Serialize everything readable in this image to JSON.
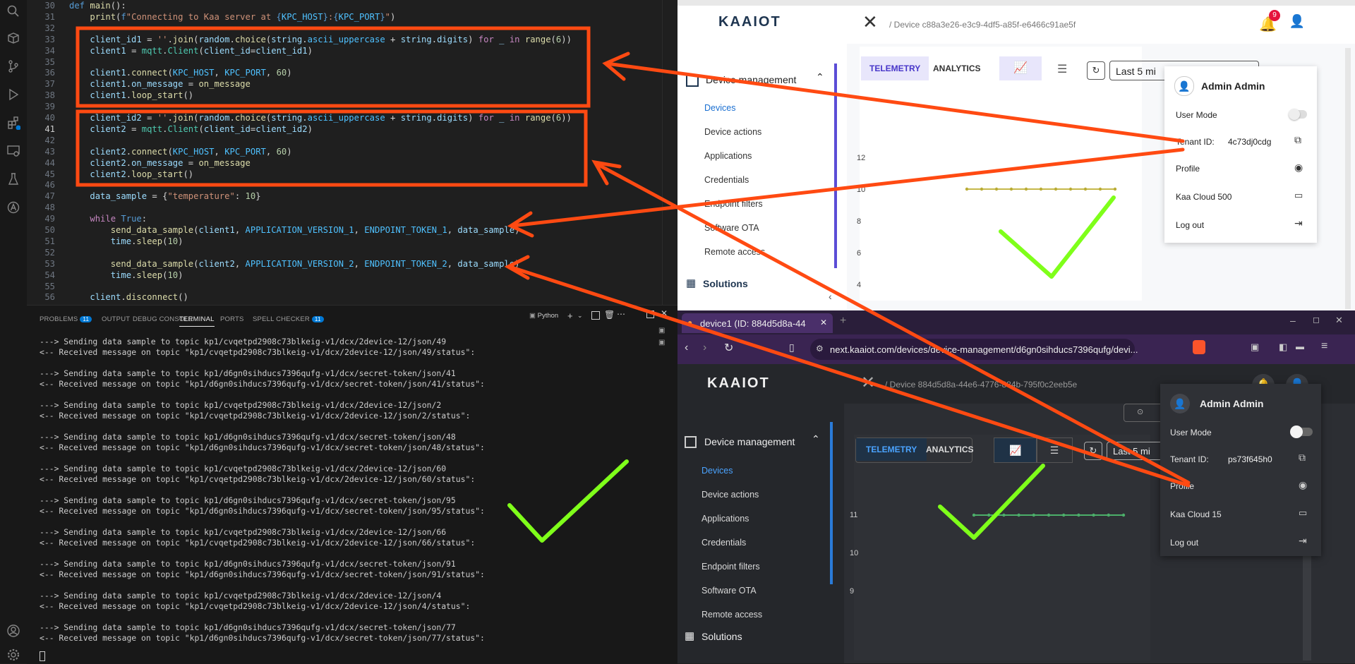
{
  "vscode": {
    "code_lines": [
      {
        "n": "30",
        "html": "<span class='kw'>def</span> <span class='fn'>main</span>():"
      },
      {
        "n": "31",
        "html": "    <span class='fn'>print</span>(<span class='kw'>f</span><span class='str'>\"Connecting to Kaa server at </span><span class='kw'>{</span><span class='const'>KPC_HOST</span><span class='kw'>}</span><span class='str'>:</span><span class='kw'>{</span><span class='const'>KPC_PORT</span><span class='kw'>}</span><span class='str'>\"</span>)"
      },
      {
        "n": "32",
        "html": ""
      },
      {
        "n": "33",
        "html": "    <span class='var'>client_id1</span> = <span class='str'>''</span>.<span class='fn'>join</span>(<span class='var'>random</span>.<span class='fn'>choice</span>(<span class='var'>string</span>.<span class='const'>ascii_uppercase</span> + <span class='var'>string</span>.<span class='var'>digits</span>) <span class='kw2'>for</span> <span class='var'>_</span> <span class='kw2'>in</span> <span class='fn'>range</span>(<span class='num'>6</span>))"
      },
      {
        "n": "34",
        "html": "    <span class='var'>client1</span> = <span class='cls'>mqtt</span>.<span class='cls'>Client</span>(<span class='var'>client_id</span>=<span class='var'>client_id1</span>)"
      },
      {
        "n": "35",
        "html": ""
      },
      {
        "n": "36",
        "html": "    <span class='var'>client1</span>.<span class='fn'>connect</span>(<span class='const'>KPC_HOST</span>, <span class='const'>KPC_PORT</span>, <span class='num'>60</span>)"
      },
      {
        "n": "37",
        "html": "    <span class='var'>client1</span>.<span class='var'>on_message</span> = <span class='fn'>on_message</span>"
      },
      {
        "n": "38",
        "html": "    <span class='var'>client1</span>.<span class='fn'>loop_start</span>()"
      },
      {
        "n": "39",
        "html": ""
      },
      {
        "n": "40",
        "html": "    <span class='var'>client_id2</span> = <span class='str'>''</span>.<span class='fn'>join</span>(<span class='var'>random</span>.<span class='fn'>choice</span>(<span class='var'>string</span>.<span class='const'>ascii_uppercase</span> + <span class='var'>string</span>.<span class='var'>digits</span>) <span class='kw2'>for</span> <span class='var'>_</span> <span class='kw2'>in</span> <span class='fn'>range</span>(<span class='num'>6</span>))"
      },
      {
        "n": "41",
        "html": "    <span class='var'>client2</span> = <span class='cls'>mqtt</span>.<span class='cls'>Client</span>(<span class='var'>client_id</span>=<span class='var'>client_id2</span>)"
      },
      {
        "n": "42",
        "html": ""
      },
      {
        "n": "43",
        "html": "    <span class='var'>client2</span>.<span class='fn'>connect</span>(<span class='const'>KPC_HOST</span>, <span class='const'>KPC_PORT</span>, <span class='num'>60</span>)"
      },
      {
        "n": "44",
        "html": "    <span class='var'>client2</span>.<span class='var'>on_message</span> = <span class='fn'>on_message</span>"
      },
      {
        "n": "45",
        "html": "    <span class='var'>client2</span>.<span class='fn'>loop_start</span>()"
      },
      {
        "n": "46",
        "html": ""
      },
      {
        "n": "47",
        "html": "    <span class='var'>data_sample</span> = {<span class='str'>\"temperature\"</span>: <span class='num'>10</span>}"
      },
      {
        "n": "48",
        "html": ""
      },
      {
        "n": "49",
        "html": "    <span class='kw2'>while</span> <span class='kw'>True</span>:"
      },
      {
        "n": "50",
        "html": "        <span class='fn'>send_data_sample</span>(<span class='var'>client1</span>, <span class='const'>APPLICATION_VERSION_1</span>, <span class='const'>ENDPOINT_TOKEN_1</span>, <span class='var'>data_sample</span>)"
      },
      {
        "n": "51",
        "html": "        <span class='var'>time</span>.<span class='fn'>sleep</span>(<span class='num'>10</span>)"
      },
      {
        "n": "52",
        "html": ""
      },
      {
        "n": "53",
        "html": "        <span class='fn'>send_data_sample</span>(<span class='var'>client2</span>, <span class='const'>APPLICATION_VERSION_2</span>, <span class='const'>ENDPOINT_TOKEN_2</span>, <span class='var'>data_sample</span>)"
      },
      {
        "n": "54",
        "html": "        <span class='var'>time</span>.<span class='fn'>sleep</span>(<span class='num'>10</span>)"
      },
      {
        "n": "55",
        "html": ""
      },
      {
        "n": "56",
        "html": "    <span class='var'>client</span>.<span class='fn'>disconnect</span>()"
      }
    ],
    "active_line": "41",
    "panel_tabs": [
      {
        "label": "PROBLEMS",
        "badge": "11"
      },
      {
        "label": "OUTPUT",
        "badge": ""
      },
      {
        "label": "DEBUG CONSOLE",
        "badge": ""
      },
      {
        "label": "TERMINAL",
        "badge": ""
      },
      {
        "label": "PORTS",
        "badge": ""
      },
      {
        "label": "SPELL CHECKER",
        "badge": "11"
      }
    ],
    "terminal_kind": "Python",
    "terminal_lines": [
      "---> Sending data sample to topic kp1/cvqetpd2908c73blkeig-v1/dcx/2device-12/json/49",
      "<-- Received message on topic \"kp1/cvqetpd2908c73blkeig-v1/dcx/2device-12/json/49/status\":",
      "",
      "---> Sending data sample to topic kp1/d6gn0sihducs7396qufg-v1/dcx/secret-token/json/41",
      "<-- Received message on topic \"kp1/d6gn0sihducs7396qufg-v1/dcx/secret-token/json/41/status\":",
      "",
      "---> Sending data sample to topic kp1/cvqetpd2908c73blkeig-v1/dcx/2device-12/json/2",
      "<-- Received message on topic \"kp1/cvqetpd2908c73blkeig-v1/dcx/2device-12/json/2/status\":",
      "",
      "---> Sending data sample to topic kp1/d6gn0sihducs7396qufg-v1/dcx/secret-token/json/48",
      "<-- Received message on topic \"kp1/d6gn0sihducs7396qufg-v1/dcx/secret-token/json/48/status\":",
      "",
      "---> Sending data sample to topic kp1/cvqetpd2908c73blkeig-v1/dcx/2device-12/json/60",
      "<-- Received message on topic \"kp1/cvqetpd2908c73blkeig-v1/dcx/2device-12/json/60/status\":",
      "",
      "---> Sending data sample to topic kp1/d6gn0sihducs7396qufg-v1/dcx/secret-token/json/95",
      "<-- Received message on topic \"kp1/d6gn0sihducs7396qufg-v1/dcx/secret-token/json/95/status\":",
      "",
      "---> Sending data sample to topic kp1/cvqetpd2908c73blkeig-v1/dcx/2device-12/json/66",
      "<-- Received message on topic \"kp1/cvqetpd2908c73blkeig-v1/dcx/2device-12/json/66/status\":",
      "",
      "---> Sending data sample to topic kp1/d6gn0sihducs7396qufg-v1/dcx/secret-token/json/91",
      "<-- Received message on topic \"kp1/d6gn0sihducs7396qufg-v1/dcx/secret-token/json/91/status\":",
      "",
      "---> Sending data sample to topic kp1/cvqetpd2908c73blkeig-v1/dcx/2device-12/json/4",
      "<-- Received message on topic \"kp1/cvqetpd2908c73blkeig-v1/dcx/2device-12/json/4/status\":",
      "",
      "---> Sending data sample to topic kp1/d6gn0sihducs7396qufg-v1/dcx/secret-token/json/77",
      "<-- Received message on topic \"kp1/d6gn0sihducs7396qufg-v1/dcx/secret-token/json/77/status\":"
    ]
  },
  "kaa1": {
    "logo": "KAAIOT",
    "breadcrumb": "Device c88a3e26-e3c9-4df5-a85f-e6466c91ae5f",
    "notif_count": "9",
    "section": "Device management",
    "nav": [
      "Devices",
      "Device actions",
      "Applications",
      "Credentials",
      "Endpoint filters",
      "Software OTA",
      "Remote access"
    ],
    "solutions": "Solutions",
    "tab_telemetry": "TELEMETRY",
    "tab_analytics": "ANALYTICS",
    "time_range": "Last 5 mi",
    "y_ticks": [
      "12",
      "10",
      "8",
      "6",
      "4"
    ],
    "menu": {
      "user": "Admin Admin",
      "user_mode": "User Mode",
      "tenant_label": "Tenant ID:",
      "tenant_value": "4c73dj0cdg",
      "profile": "Profile",
      "plan": "Kaa Cloud 500",
      "logout": "Log out"
    }
  },
  "kaa2": {
    "tab_title": "device1 (ID: 884d5d8a-44",
    "url": "next.kaaiot.com/devices/device-management/d6gn0sihducs7396qufg/devi...",
    "logo": "KAAIOT",
    "breadcrumb": "Device 884d5d8a-44e6-4776-884b-795f0c2eeb5e",
    "section": "Device management",
    "nav": [
      "Devices",
      "Device actions",
      "Applications",
      "Credentials",
      "Endpoint filters",
      "Software OTA",
      "Remote access"
    ],
    "solutions": "Solutions",
    "tab_telemetry": "TELEMETRY",
    "tab_analytics": "ANALYTICS",
    "time_range": "Last 5 mi",
    "y_ticks": [
      "11",
      "10",
      "9"
    ],
    "menu": {
      "user": "Admin Admin",
      "user_mode": "User Mode",
      "tenant_label": "Tenant ID:",
      "tenant_value": "ps73f645h0",
      "profile": "Profile",
      "plan": "Kaa Cloud 15",
      "logout": "Log out"
    }
  },
  "colors": {
    "annotation": "#ff4a12",
    "check": "#7fff1a",
    "kaa_blue": "#1a6fd1"
  }
}
